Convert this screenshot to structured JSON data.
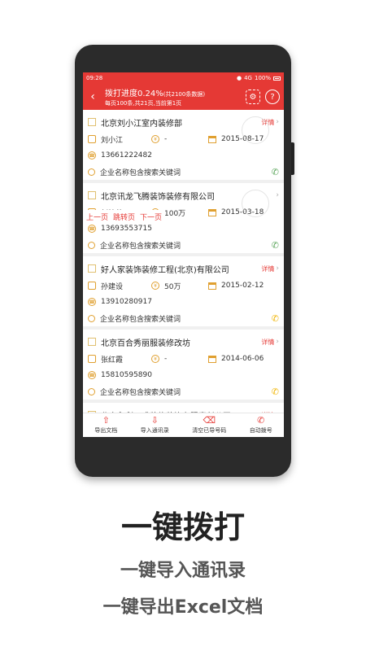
{
  "status_bar": {
    "time": "09:28",
    "network": "4G",
    "battery": "100%"
  },
  "header": {
    "progress": "拨打进度0.24%",
    "progress_note": "(共2100条数据)",
    "page_info": "每页100条,共21页,当前第1页"
  },
  "pager": {
    "prev": "上一页",
    "jump": "跳转页",
    "next": "下一页"
  },
  "detail_label": "详情",
  "cards": [
    {
      "company": "北京刘小江室内装修部",
      "contact": "刘小江",
      "capital": "-",
      "date": "2015-08-17",
      "phone": "13661222482",
      "keyword": "企业名称包含搜索关键词",
      "call_color": "green"
    },
    {
      "company": "北京讯龙飞腾装饰装修有限公司",
      "contact": "刘桂英",
      "capital": "100万",
      "date": "2015-03-18",
      "phone": "13693553715",
      "keyword": "企业名称包含搜索关键词",
      "call_color": "green"
    },
    {
      "company": "好人家装饰装修工程(北京)有限公司",
      "contact": "孙建设",
      "capital": "50万",
      "date": "2015-02-12",
      "phone": "13910280917",
      "keyword": "企业名称包含搜索关键词",
      "call_color": "yellow"
    },
    {
      "company": "北京百合秀丽服装修改坊",
      "contact": "张红霞",
      "capital": "-",
      "date": "2014-06-06",
      "phone": "15810595890",
      "keyword": "企业名称包含搜索关键词",
      "call_color": "yellow"
    },
    {
      "company": "北京永利双盛装修装饰有限责任公司"
    }
  ],
  "bottom_bar": [
    {
      "label": "导出文档",
      "icon": "upload-icon"
    },
    {
      "label": "导入通讯录",
      "icon": "download-icon"
    },
    {
      "label": "清空已导号码",
      "icon": "trash-icon"
    },
    {
      "label": "自动拨号",
      "icon": "auto-dial-icon"
    }
  ],
  "captions": {
    "main": "一键拨打",
    "line2": "一键导入通讯录",
    "line3": "一键导出Excel文档"
  },
  "colors": {
    "accent": "#e53935",
    "icon_gold": "#e0a030",
    "call_green": "#5aa55a",
    "call_yellow": "#f0b400"
  }
}
